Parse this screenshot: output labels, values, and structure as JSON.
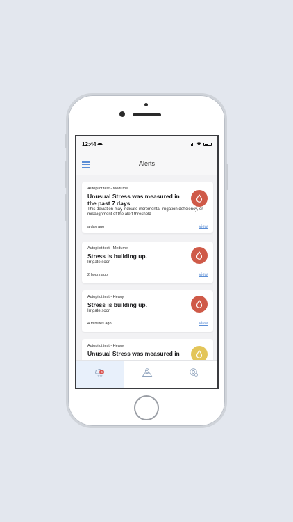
{
  "status": {
    "time": "12:44"
  },
  "nav": {
    "title": "Alerts"
  },
  "alerts": [
    {
      "source": "Autopilot test - Medume",
      "title": "Unusual Stress was measured in the past 7 days",
      "description": "This deviation may indicate incremental irrigation deficiency, or misalignment of the alert threshold",
      "time": "a day ago",
      "view": "View",
      "severity_color": "#cf5a48"
    },
    {
      "source": "Autopilot test - Medume",
      "title": "Stress is building up.",
      "description": "Irrigate soon",
      "time": "2 hours ago",
      "view": "View",
      "severity_color": "#cf5a48"
    },
    {
      "source": "Autopilot test - Heavy",
      "title": "Stress is building up.",
      "description": "Irrigate soon",
      "time": "4 minutes ago",
      "view": "View",
      "severity_color": "#cf5a48"
    },
    {
      "source": "Autopilot test - Heavy",
      "title": "Unusual Stress was measured in",
      "severity_color": "#e3c559"
    }
  ],
  "tabbar": {
    "items": [
      {
        "icon": "alerts-icon",
        "badge": "4",
        "active": true
      },
      {
        "icon": "map-icon"
      },
      {
        "icon": "settings-icon"
      }
    ]
  },
  "colors": {
    "accent": "#5b8ed6",
    "alert_red": "#cf5a48",
    "alert_yellow": "#e3c559"
  }
}
